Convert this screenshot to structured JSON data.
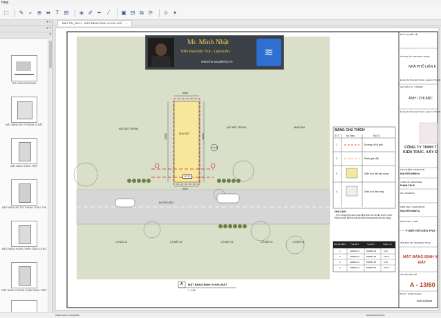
{
  "menubar": {
    "label": "Help"
  },
  "tab": {
    "label": "BẢO TÍN_REV1 - MẶT BẰNG ĐỊNH VỊ KHU ĐẤT",
    "close": "×"
  },
  "thumbnails": [
    {
      "label": "BỐ KHÓA DIAGRAM"
    },
    {
      "label": "MẶT BẰNG BỐ TRÍ ĐỊNH VỊ ĐẤT"
    },
    {
      "label": "MẶT BẰNG TẦNG TRỆT"
    },
    {
      "label": "MẶT BẰNG BỐ TRÍ THÀNH TỔNG THỂ"
    },
    {
      "label": "MẶT BẰNG HOÀN THIỆN TẦNG LỬNG"
    },
    {
      "label": "MẶT BẰNG CHỐNG THẤM TẦNG TRỆT"
    },
    {
      "label": "MẶT BẰNG"
    }
  ],
  "banner": {
    "name": "Mr. Minh Nhật",
    "subtitle": "Triển khai Kiến Trúc - Layout Arc",
    "website": "www.hs-academy.vn"
  },
  "site": {
    "dim_top": "5000",
    "dim_bottom": "5000",
    "dim_right": "18000",
    "dim_left": "15000",
    "lot_label": "KHU ĐẤT",
    "lot_sub": "LÔ 01",
    "marker_label": "ĐẤT",
    "road_label": "ĐƯỜNG ĐẤT",
    "label_left": "ĐẤT ĐẤT TRỐNG",
    "label_right": "ĐẤT ĐẤT TRỐNG",
    "label_right2": "NHÀ DÂN",
    "north": "N",
    "lower_labels": [
      "LÔ ĐẤT 01",
      "LÔ ĐẤT 02",
      "LÔ ĐẤT 03",
      "LÔ ĐẤT 04",
      "LÔ ĐẤT 05"
    ]
  },
  "legend": {
    "title": "BẢNG CHÚ THÍCH",
    "headers": [
      "STT",
      "Ký Hiệu",
      "Mô Tả"
    ],
    "rows": [
      {
        "stt": "1",
        "desc": "Đường chỉ lộ giới"
      },
      {
        "stt": "2",
        "desc": "Ranh giới đất"
      },
      {
        "stt": "3",
        "desc": "Diện tích đất xây dựng"
      },
      {
        "stt": "4",
        "desc": "Diện tích đất trống"
      }
    ],
    "note_title": "GHI CHÚ",
    "note_text": "- Vị trí công trình được xác định theo hồ sơ địa chính. Kích thước được kiểm tra lại tại hiện trường trước khi thi công."
  },
  "coord_table": {
    "headers": [
      "Số hiệu điểm",
      "Tọa độ X",
      "Tọa độ Y",
      "Cạnh (m)"
    ],
    "rows": [
      [
        "1",
        "1186828.3",
        "598848.56",
        "5.00"
      ],
      [
        "2",
        "1186828.3",
        "598853.56",
        "18.00"
      ],
      [
        "3",
        "1186810.3",
        "598853.56",
        "5.00"
      ],
      [
        "4",
        "1186810.3",
        "598848.56",
        "18.00"
      ]
    ]
  },
  "caption": {
    "letter": "A",
    "title": "MẶT BẰNG ĐỊNH VỊ KHU ĐẤT",
    "scale": "1 : 100"
  },
  "titleblock": {
    "design_unit_label": "ĐƠN VỊ THIẾT KẾ",
    "project_label": "TÊN DỰ ÁN / PROJECT NAME",
    "project": "NHÀ PHỐ LIÊN K",
    "address_label": "Đường Số Phường Thủ Đức, Quận 9, TP.HCM",
    "investor_label": "CHỦ ĐẦU TƯ / OWNER",
    "investor": "ANH / CHỊ ABC",
    "investor_addr": "Đường Số Phường Thủ Đức, Quận 9, TP.HCM",
    "company": "CÔNG TY TNHH T",
    "company2": "KIẾN TRÚC- XÂY D",
    "manager_label": "CHỦ NHIỆM / DIRECTOR",
    "manager": "NGUYỄN MINH A",
    "designer_label": "THIẾT KẾ / DESIGNER",
    "designer": "PHẠM CHI B",
    "drawn_label": "VẼ / DRAWING",
    "checker_label": "KIỂM TRA / CHECKED BY",
    "checker": "NGUYỄN MINH A",
    "category_label": "HẠNG MỤC / ITEM",
    "category": "THIẾT KẾ KIẾN TRÚ",
    "drawing_title_label": "TÊN BẢN VẼ / DRAWING TITLE",
    "drawing_title": "MẶT BẰNG ĐỊNH VỊ",
    "drawing_title2": "ĐẤT",
    "sheet_label": "SỐ HIỆU BẢN VẼ",
    "sheet_no": "A - 13/60",
    "date_label": "NGÀY / HOÀN THÀNH",
    "date": "20/12/2024"
  },
  "status": {
    "left": "Auto save complete",
    "right": "Measurements"
  },
  "colors": {
    "accent": "#d11a2a",
    "lot_fill": "#f6e79a",
    "grass": "#d9dfc9",
    "road": "#d6d6d6"
  }
}
